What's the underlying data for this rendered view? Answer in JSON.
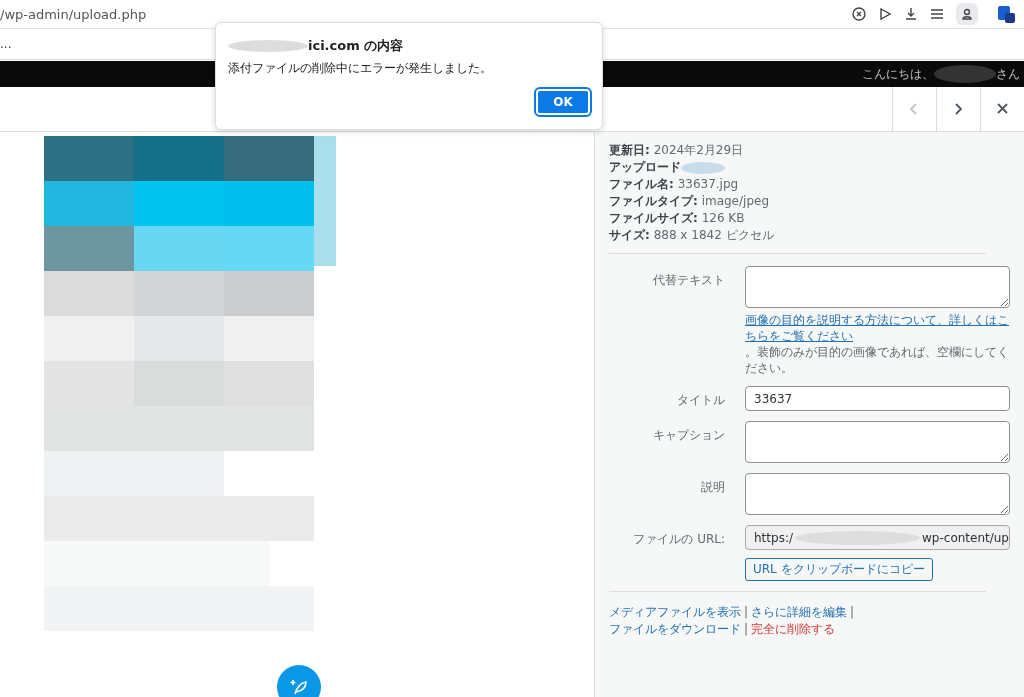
{
  "browser": {
    "url": "/wp-admin/upload.php",
    "bookmarks_text": "..."
  },
  "admin_bar": {
    "greeting": "こんにちは、",
    "suffix": "さん"
  },
  "modal_nav": [
    {
      "kind": "prev",
      "disabled": true
    },
    {
      "kind": "next",
      "disabled": false
    },
    {
      "kind": "close",
      "disabled": false
    }
  ],
  "details": [
    {
      "label": "更新日:",
      "value": "2024年2月29日"
    },
    {
      "label": "アップロード",
      "redacted": true
    },
    {
      "label": "ファイル名:",
      "value": "33637.jpg"
    },
    {
      "label": "ファイルタイプ:",
      "value": "image/jpeg"
    },
    {
      "label": "ファイルサイズ:",
      "value": "126 KB"
    },
    {
      "label": "サイズ:",
      "value": "888 x 1842 ピクセル"
    }
  ],
  "fields": [
    {
      "label": "代替テキスト",
      "kind": "textarea",
      "help_link": "画像の目的を説明する方法について、詳しくはこちらをご覧ください",
      "help_text": "。装飾のみが目的の画像であれば、空欄にしてください。"
    },
    {
      "label": "タイトル",
      "kind": "input",
      "value": "33637"
    },
    {
      "label": "キャプション",
      "kind": "textarea"
    },
    {
      "label": "説明",
      "kind": "textarea"
    },
    {
      "label": "ファイルの URL:",
      "kind": "url",
      "value_start": "https:/",
      "value_end": "wp-content/up",
      "button": "URL をクリップボードにコピー"
    }
  ],
  "actions": [
    {
      "label": "メディアファイルを表示",
      "kind": "link",
      "separator": "|"
    },
    {
      "label": "さらに詳細を編集",
      "kind": "link",
      "separator": "|"
    },
    {
      "label": "ファイルをダウンロード",
      "kind": "link",
      "separator": "|"
    },
    {
      "label": "完全に削除する",
      "kind": "danger"
    }
  ],
  "dialog": {
    "title": "ici.com の内容",
    "message": "添付ファイルの削除中にエラーが発生しました。",
    "button": "OK"
  }
}
